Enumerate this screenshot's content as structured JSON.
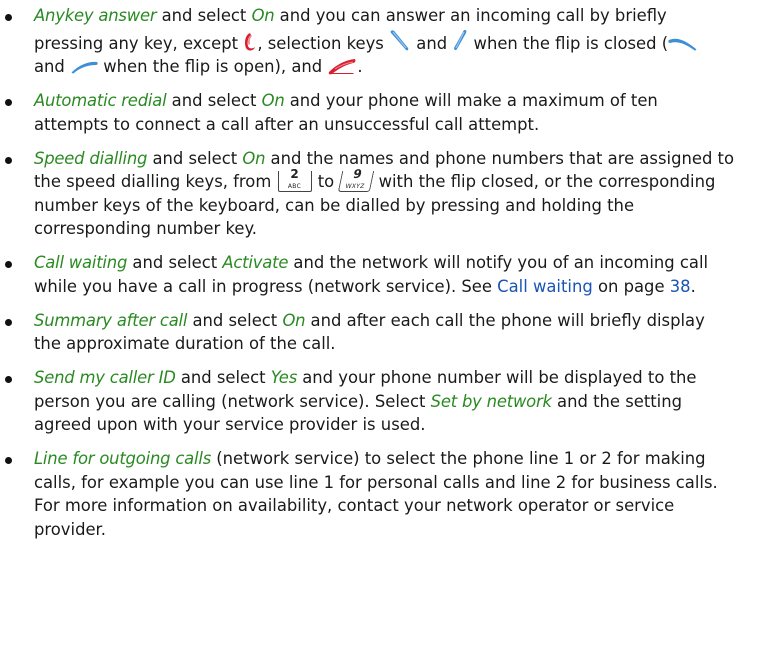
{
  "items": [
    {
      "option": "Anykey answer",
      "t1": " and select ",
      "value": "On",
      "t2": " and you can answer an incoming call by briefly pressing any key, except ",
      "t3": ", selection keys ",
      "t4": " and ",
      "t5": " when the flip is closed (",
      "t6": " and ",
      "t7": " when the flip is open), and ",
      "t8": "."
    },
    {
      "option": "Automatic redial",
      "t1": " and select ",
      "value": "On",
      "t2": " and your phone will make a maximum of ten attempts to connect a call after an unsuccessful call attempt."
    },
    {
      "option": "Speed dialling",
      "t1": " and select ",
      "value": "On",
      "t2": " and the names and phone numbers that are assigned to the speed dialling keys, from ",
      "key_from": {
        "digit": "2",
        "letters": "ABC"
      },
      "t3": " to ",
      "key_to": {
        "digit": "9",
        "letters": "WXYZ"
      },
      "t4": " with the flip closed, or the corresponding number keys of the keyboard, can be dialled by pressing and holding the corresponding number key."
    },
    {
      "option": "Call waiting",
      "t1": " and select ",
      "value": "Activate",
      "t2": " and the network will notify you of an incoming call while you have a call in progress (network service). See ",
      "link": "Call waiting",
      "t3": " on page ",
      "page": "38",
      "t4": "."
    },
    {
      "option": "Summary after call",
      "t1": " and select ",
      "value": "On",
      "t2": " and after each call the phone will briefly display the approximate duration of the call."
    },
    {
      "option": "Send my caller ID",
      "t1": " and select ",
      "value": "Yes",
      "t2": " and your phone number will be displayed to the person you are calling (network service). Select ",
      "value2": "Set by network",
      "t3": " and the setting agreed upon with your service provider is used."
    },
    {
      "option": "Line for outgoing calls",
      "t1": " (network service) to select the phone line 1 or 2 for making calls, for example you can use line 1 for personal calls and line 2 for business calls. For more information on availability, contact your network operator or service provider."
    }
  ],
  "colors": {
    "option_text": "#2a8a22",
    "link_text": "#1a55b5",
    "end_key": "#d8202e",
    "selection_key": "#3d8fd6"
  },
  "icons": [
    "end-key-icon",
    "left-selection-key-icon",
    "right-selection-key-icon",
    "left-selection-key-open-icon",
    "right-selection-key-open-icon",
    "call-end-icon"
  ]
}
